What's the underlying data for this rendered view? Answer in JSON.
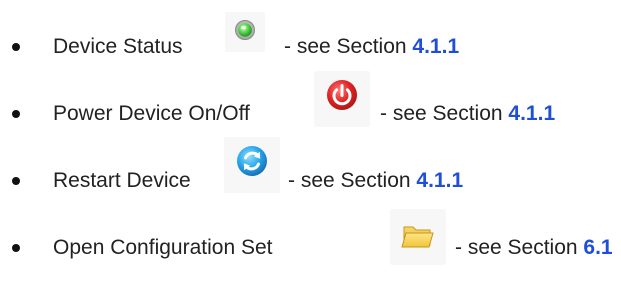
{
  "list": {
    "items": [
      {
        "label": "Device Status",
        "icon": "status-light-green-icon",
        "see_prefix": "- see Section",
        "section": "4.1.1"
      },
      {
        "label": "Power Device On/Off",
        "icon": "power-button-red-icon",
        "see_prefix": "- see Section",
        "section": "4.1.1"
      },
      {
        "label": "Restart Device",
        "icon": "restart-blue-icon",
        "see_prefix": "- see Section",
        "section": "4.1.1"
      },
      {
        "label": "Open Configuration Set",
        "icon": "folder-open-icon",
        "see_prefix": "- see Section",
        "section": "6.1"
      }
    ]
  },
  "colors": {
    "text": "#222222",
    "link": "#1f4ed8",
    "status_green": "#34c759",
    "power_red": "#d92b2b",
    "restart_blue": "#25a0e8",
    "folder_yellow": "#f1c232"
  }
}
